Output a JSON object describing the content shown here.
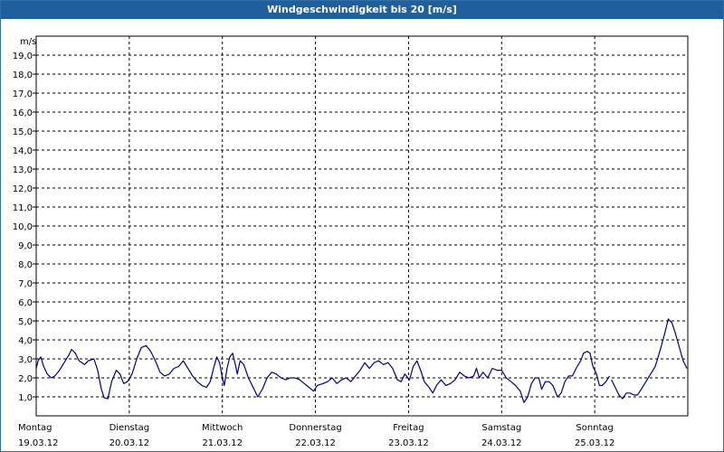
{
  "window": {
    "title": "Windgeschwindigkeit bis 20 [m/s]"
  },
  "chart_data": {
    "type": "line",
    "title": "Windgeschwindigkeit bis 20 [m/s]",
    "ylabel": "m/s",
    "xlabel": "",
    "ylim": [
      0,
      20
    ],
    "yticks": [
      "1,0",
      "2,0",
      "3,0",
      "4,0",
      "5,0",
      "6,0",
      "7,0",
      "8,0",
      "9,0",
      "10,0",
      "11,0",
      "12,0",
      "13,0",
      "14,0",
      "15,0",
      "16,0",
      "17,0",
      "18,0",
      "19,0"
    ],
    "grid": true,
    "grid_style": "dashed",
    "xlim_days": [
      0,
      7
    ],
    "days": [
      {
        "day": "Montag",
        "date": "19.03.12"
      },
      {
        "day": "Dienstag",
        "date": "20.03.12"
      },
      {
        "day": "Mittwoch",
        "date": "21.03.12"
      },
      {
        "day": "Donnerstag",
        "date": "22.03.12"
      },
      {
        "day": "Freitag",
        "date": "23.03.12"
      },
      {
        "day": "Samstag",
        "date": "24.03.12"
      },
      {
        "day": "Sonntag",
        "date": "25.03.12"
      }
    ],
    "series": [
      {
        "color": "#000080",
        "segments": [
          [
            [
              0.0,
              2.5
            ],
            [
              0.02,
              2.9
            ],
            [
              0.05,
              3.1
            ],
            [
              0.08,
              2.6
            ],
            [
              0.12,
              2.2
            ],
            [
              0.16,
              2.0
            ],
            [
              0.2,
              2.1
            ],
            [
              0.25,
              2.4
            ],
            [
              0.3,
              2.8
            ],
            [
              0.35,
              3.2
            ],
            [
              0.38,
              3.5
            ],
            [
              0.42,
              3.3
            ],
            [
              0.46,
              2.9
            ],
            [
              0.52,
              2.7
            ],
            [
              0.56,
              2.9
            ],
            [
              0.62,
              3.0
            ],
            [
              0.66,
              2.4
            ],
            [
              0.7,
              1.4
            ],
            [
              0.73,
              0.95
            ],
            [
              0.77,
              0.9
            ],
            [
              0.81,
              1.8
            ],
            [
              0.86,
              2.4
            ],
            [
              0.9,
              2.2
            ],
            [
              0.94,
              1.7
            ],
            [
              0.98,
              1.8
            ],
            [
              1.03,
              2.2
            ],
            [
              1.08,
              3.0
            ],
            [
              1.13,
              3.6
            ],
            [
              1.18,
              3.7
            ],
            [
              1.23,
              3.4
            ],
            [
              1.28,
              2.9
            ],
            [
              1.33,
              2.3
            ],
            [
              1.38,
              2.1
            ],
            [
              1.43,
              2.2
            ],
            [
              1.48,
              2.5
            ],
            [
              1.53,
              2.6
            ],
            [
              1.58,
              2.9
            ],
            [
              1.63,
              2.5
            ],
            [
              1.68,
              2.1
            ],
            [
              1.73,
              1.8
            ],
            [
              1.78,
              1.6
            ],
            [
              1.83,
              1.5
            ],
            [
              1.87,
              1.8
            ],
            [
              1.91,
              2.6
            ],
            [
              1.94,
              3.1
            ],
            [
              1.97,
              2.8
            ],
            [
              2.0,
              2.0
            ],
            [
              2.02,
              1.6
            ],
            [
              2.05,
              2.5
            ],
            [
              2.08,
              3.1
            ],
            [
              2.11,
              3.3
            ],
            [
              2.14,
              2.7
            ],
            [
              2.16,
              2.2
            ],
            [
              2.19,
              2.9
            ],
            [
              2.23,
              2.7
            ],
            [
              2.28,
              2.0
            ],
            [
              2.33,
              1.5
            ],
            [
              2.38,
              1.0
            ],
            [
              2.43,
              1.4
            ],
            [
              2.48,
              2.0
            ],
            [
              2.53,
              2.3
            ],
            [
              2.58,
              2.2
            ],
            [
              2.63,
              2.0
            ],
            [
              2.68,
              1.9
            ],
            [
              2.73,
              2.0
            ],
            [
              2.78,
              2.0
            ],
            [
              2.83,
              1.9
            ],
            [
              2.88,
              1.7
            ],
            [
              2.93,
              1.5
            ],
            [
              2.98,
              1.3
            ],
            [
              3.02,
              1.6
            ],
            [
              3.08,
              1.7
            ],
            [
              3.13,
              1.8
            ],
            [
              3.18,
              2.0
            ],
            [
              3.23,
              1.7
            ],
            [
              3.28,
              1.9
            ],
            [
              3.33,
              2.0
            ],
            [
              3.38,
              1.8
            ],
            [
              3.43,
              2.1
            ],
            [
              3.48,
              2.4
            ],
            [
              3.53,
              2.8
            ],
            [
              3.58,
              2.5
            ],
            [
              3.63,
              2.8
            ],
            [
              3.68,
              2.9
            ],
            [
              3.73,
              2.7
            ],
            [
              3.78,
              2.8
            ],
            [
              3.83,
              2.5
            ],
            [
              3.88,
              1.9
            ],
            [
              3.92,
              1.8
            ],
            [
              3.96,
              2.2
            ],
            [
              4.01,
              1.9
            ],
            [
              4.05,
              2.6
            ],
            [
              4.09,
              2.9
            ],
            [
              4.13,
              2.4
            ],
            [
              4.17,
              1.8
            ],
            [
              4.22,
              1.5
            ],
            [
              4.26,
              1.2
            ],
            [
              4.3,
              1.6
            ],
            [
              4.35,
              1.9
            ],
            [
              4.4,
              1.6
            ],
            [
              4.45,
              1.7
            ],
            [
              4.5,
              1.9
            ],
            [
              4.55,
              2.3
            ],
            [
              4.6,
              2.1
            ],
            [
              4.65,
              2.0
            ],
            [
              4.7,
              2.1
            ],
            [
              4.73,
              2.5
            ],
            [
              4.76,
              2.0
            ],
            [
              4.8,
              2.3
            ],
            [
              4.85,
              2.0
            ],
            [
              4.9,
              2.5
            ],
            [
              4.95,
              2.4
            ],
            [
              5.0,
              2.4
            ],
            [
              5.05,
              2.0
            ],
            [
              5.1,
              1.8
            ],
            [
              5.15,
              1.6
            ],
            [
              5.2,
              1.3
            ],
            [
              5.24,
              0.7
            ],
            [
              5.28,
              1.0
            ],
            [
              5.32,
              1.7
            ],
            [
              5.36,
              2.0
            ],
            [
              5.4,
              2.0
            ],
            [
              5.43,
              1.4
            ],
            [
              5.47,
              1.8
            ],
            [
              5.51,
              1.8
            ],
            [
              5.55,
              1.6
            ],
            [
              5.6,
              1.0
            ],
            [
              5.64,
              1.2
            ],
            [
              5.68,
              1.8
            ],
            [
              5.72,
              2.1
            ],
            [
              5.76,
              2.1
            ],
            [
              5.8,
              2.5
            ],
            [
              5.85,
              2.9
            ],
            [
              5.88,
              3.3
            ],
            [
              5.92,
              3.4
            ],
            [
              5.95,
              3.3
            ],
            [
              5.98,
              2.6
            ],
            [
              6.02,
              2.2
            ],
            [
              6.05,
              1.6
            ],
            [
              6.08,
              1.6
            ],
            [
              6.12,
              1.8
            ],
            [
              6.16,
              2.1
            ]
          ],
          [
            [
              6.18,
              1.9
            ],
            [
              6.22,
              1.5
            ],
            [
              6.26,
              1.1
            ],
            [
              6.3,
              0.9
            ],
            [
              6.34,
              1.2
            ],
            [
              6.38,
              1.2
            ],
            [
              6.42,
              1.1
            ],
            [
              6.46,
              1.1
            ],
            [
              6.5,
              1.4
            ],
            [
              6.55,
              1.8
            ],
            [
              6.6,
              2.2
            ],
            [
              6.65,
              2.6
            ],
            [
              6.7,
              3.4
            ],
            [
              6.75,
              4.3
            ],
            [
              6.79,
              5.1
            ],
            [
              6.83,
              4.9
            ],
            [
              6.87,
              4.3
            ],
            [
              6.91,
              3.6
            ],
            [
              6.95,
              2.9
            ],
            [
              6.99,
              2.5
            ]
          ]
        ]
      }
    ]
  }
}
